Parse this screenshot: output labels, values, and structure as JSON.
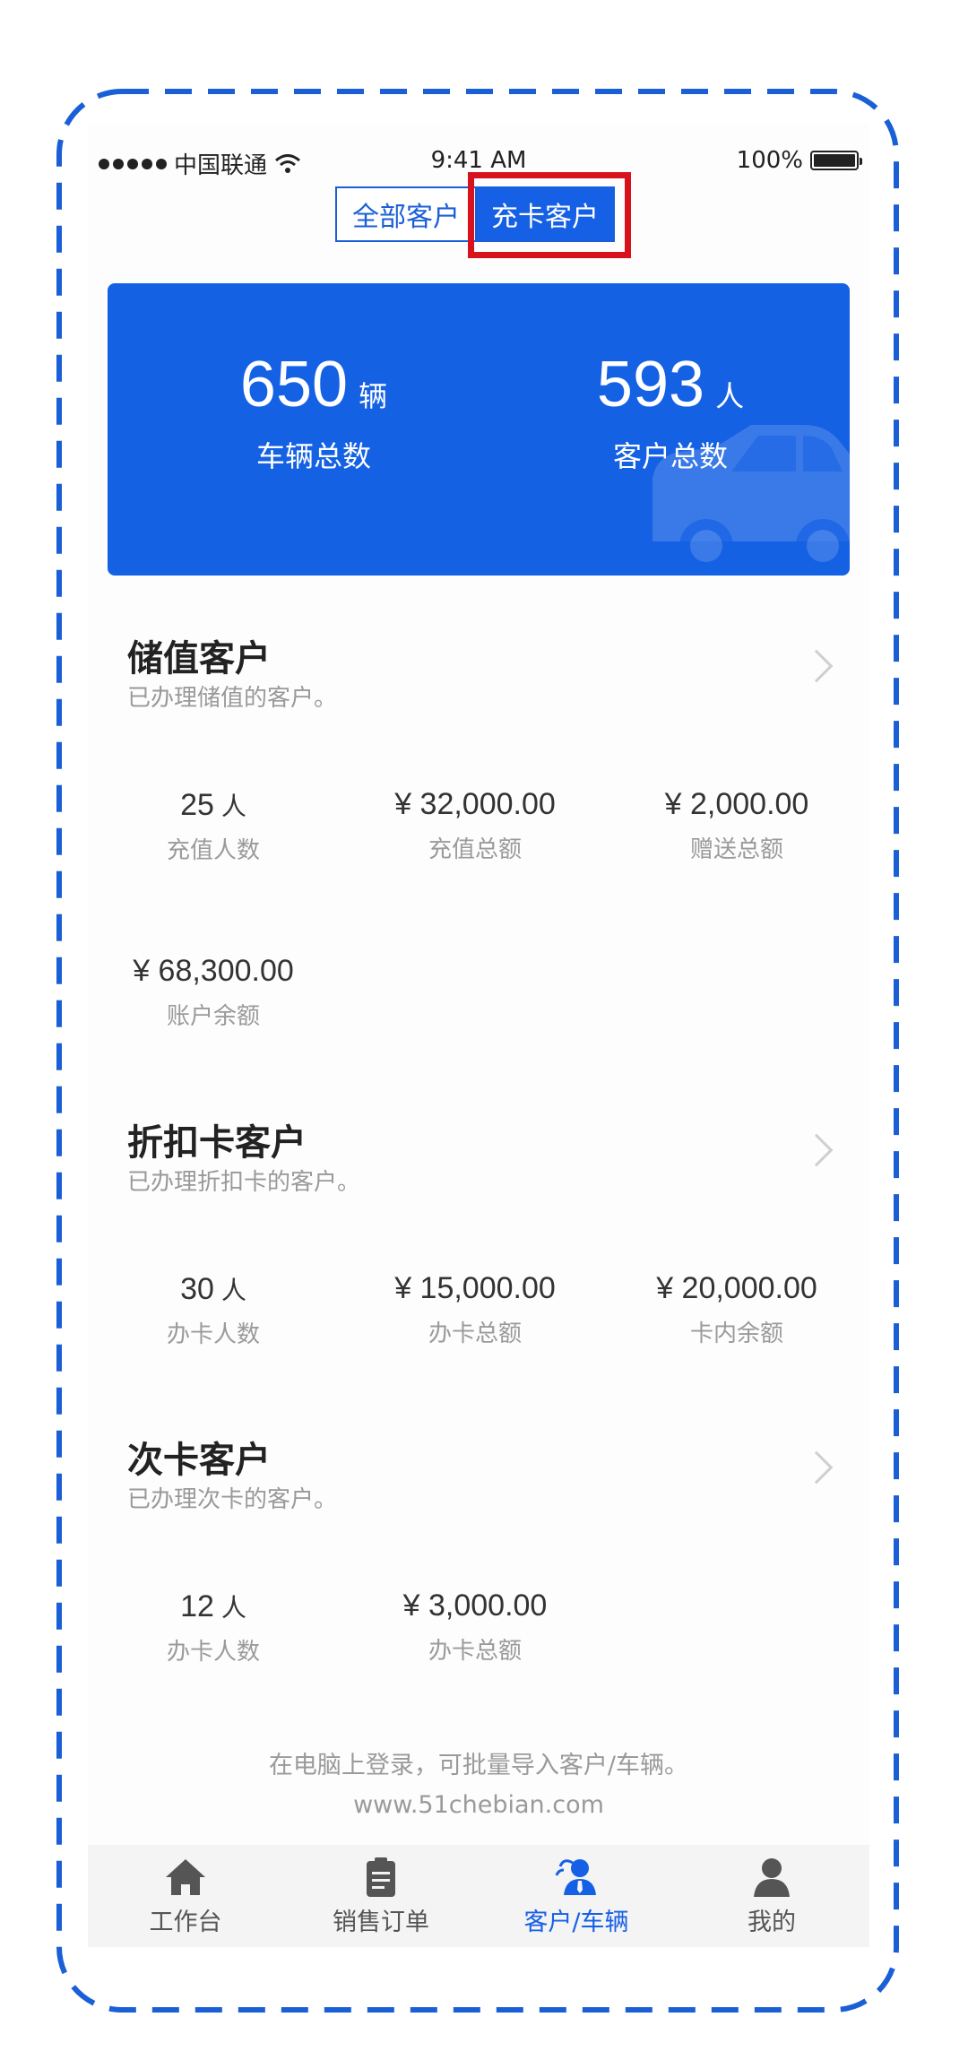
{
  "status_bar": {
    "carrier": "中国联通",
    "time": "9:41 AM",
    "battery": "100%"
  },
  "segment": {
    "tabs": [
      "全部客户",
      "充卡客户"
    ],
    "active_index": 1
  },
  "summary": {
    "vehicles": {
      "value": "650",
      "unit": "辆",
      "label": "车辆总数"
    },
    "customers": {
      "value": "593",
      "unit": "人",
      "label": "客户总数"
    }
  },
  "sections": [
    {
      "title": "储值客户",
      "desc": "已办理储值的客户。",
      "metrics": [
        {
          "value": "25",
          "unit": "人",
          "label": "充值人数"
        },
        {
          "value": "¥ 32,000.00",
          "unit": "",
          "label": "充值总额"
        },
        {
          "value": "¥ 2,000.00",
          "unit": "",
          "label": "赠送总额"
        },
        {
          "value": "¥ 68,300.00",
          "unit": "",
          "label": "账户余额"
        }
      ]
    },
    {
      "title": "折扣卡客户",
      "desc": "已办理折扣卡的客户。",
      "metrics": [
        {
          "value": "30",
          "unit": "人",
          "label": "办卡人数"
        },
        {
          "value": "¥ 15,000.00",
          "unit": "",
          "label": "办卡总额"
        },
        {
          "value": "¥ 20,000.00",
          "unit": "",
          "label": "卡内余额"
        }
      ]
    },
    {
      "title": "次卡客户",
      "desc": "已办理次卡的客户。",
      "metrics": [
        {
          "value": "12",
          "unit": "人",
          "label": "办卡人数"
        },
        {
          "value": "¥ 3,000.00",
          "unit": "",
          "label": "办卡总额"
        }
      ]
    }
  ],
  "footer": {
    "note": "在电脑上登录，可批量导入客户/车辆。",
    "url": "www.51chebian.com"
  },
  "tabbar": {
    "items": [
      {
        "label": "工作台",
        "icon": "home-icon"
      },
      {
        "label": "销售订单",
        "icon": "clipboard-icon"
      },
      {
        "label": "客户/车辆",
        "icon": "customer-icon"
      },
      {
        "label": "我的",
        "icon": "user-icon"
      }
    ],
    "active_index": 2
  },
  "colors": {
    "primary": "#1660e6",
    "card": "#1561e4",
    "highlight": "#d8121c",
    "frame_dash": "#1a5fd6"
  }
}
